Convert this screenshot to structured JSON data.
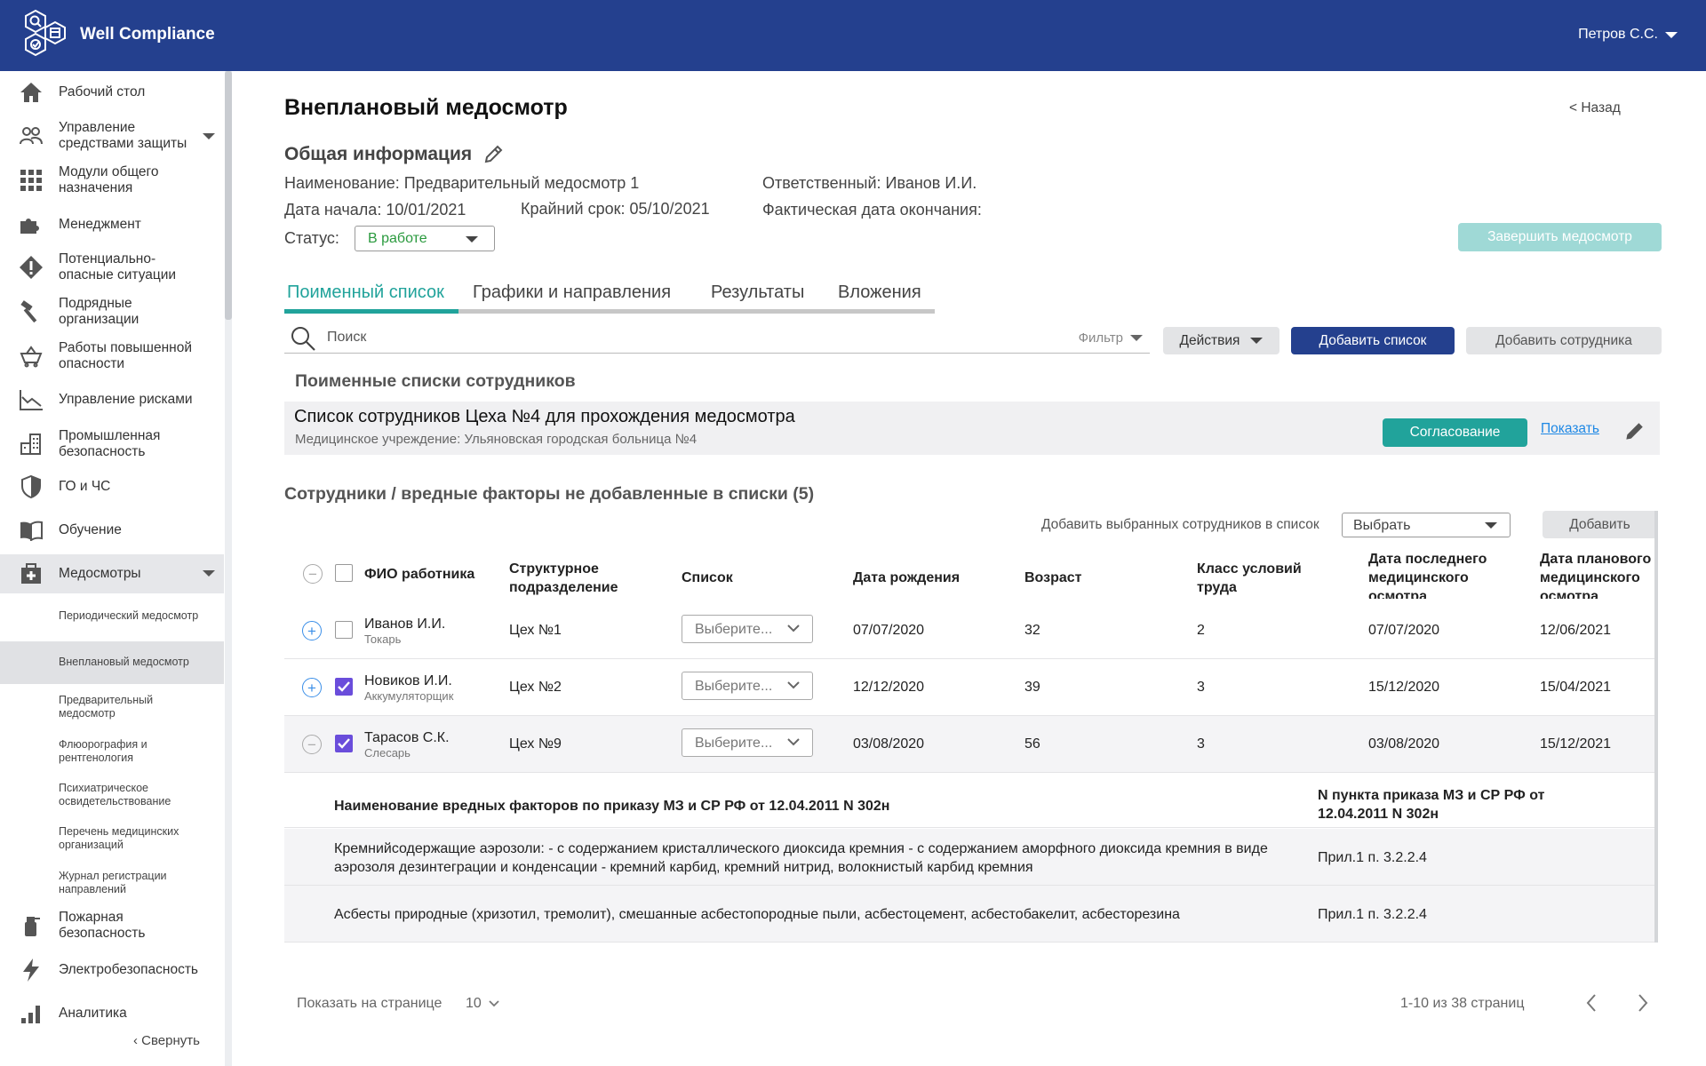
{
  "header": {
    "brand": "Well Compliance",
    "user": "Петров С.С."
  },
  "sidebar": {
    "items": [
      {
        "label": "Рабочий стол",
        "icon": "home-icon"
      },
      {
        "label": "Управление средствами защиты",
        "icon": "users-icon"
      },
      {
        "label": "Модули общего назначения",
        "icon": "grid-icon"
      },
      {
        "label": "Менеджмент",
        "icon": "puzzle-icon"
      },
      {
        "label": "Потенциально-опасные ситуации",
        "icon": "warning-icon"
      },
      {
        "label": "Подрядные организации",
        "icon": "hammer-icon"
      },
      {
        "label": "Работы повышенной опасности",
        "icon": "cart-icon"
      },
      {
        "label": "Управление рисками",
        "icon": "chart-line-icon"
      },
      {
        "label": "Промышленная безопасность",
        "icon": "building-icon"
      },
      {
        "label": "ГО и ЧС",
        "icon": "shield-icon"
      },
      {
        "label": "Обучение",
        "icon": "book-icon"
      },
      {
        "label": "Медосмотры",
        "icon": "medkit-icon"
      },
      {
        "label": "Пожарная безопасность",
        "icon": "fire-extinguisher-icon"
      },
      {
        "label": "Электробезопасность",
        "icon": "lightning-icon"
      },
      {
        "label": "Аналитика",
        "icon": "bar-chart-icon"
      }
    ],
    "subitems": [
      "Периодический медосмотр",
      "Внеплановый медосмотр",
      "Предварительный медосмотр",
      "Флюорография и рентгенология",
      "Психиатрическое освидетельствование",
      "Перечень медицинских организаций",
      "Журнал регистрации направлений"
    ],
    "collapse": "‹ Свернуть"
  },
  "page": {
    "title": "Внеплановый медосмотр",
    "back": "<   Назад",
    "section_title": "Общая информация",
    "name": "Наименование: Предварительный медосмотр 1",
    "start": "Дата начала: 10/01/2021",
    "deadline": "Крайний срок: 05/10/2021",
    "responsible": "Ответственный: Иванов И.И.",
    "actual_end": "Фактическая дата окончания:",
    "status_label": "Статус:",
    "status_value": "В работе",
    "finish_button": "Завершить медосмотр",
    "status_color": "#2a9a3e"
  },
  "tabs": [
    "Поименный список",
    "Графики и направления",
    "Результаты",
    "Вложения"
  ],
  "toolbar": {
    "search_placeholder": "Поиск",
    "filter": "Фильтр",
    "actions": "Действия",
    "add_list": "Добавить список",
    "add_employee": "Добавить сотрудника"
  },
  "lists": {
    "title": "Поименные списки сотрудников",
    "items": [
      {
        "name": "Список сотрудников Цеха №4 для прохождения медосмотра",
        "institution": "Медицинское учреждение: Ульяновская городская больница №4",
        "approve": "Согласование",
        "show": "Показать"
      }
    ]
  },
  "unassigned": {
    "title": "Сотрудники / вредные факторы не добавленные в списки (5)",
    "add_label": "Добавить выбранных сотрудников в список",
    "select": "Выбрать",
    "add_button": "Добавить",
    "columns": {
      "name": "ФИО работника",
      "dept": "Структурное подразделение",
      "list": "Список",
      "birth": "Дата рождения",
      "age": "Возраст",
      "class": "Класс условий труда",
      "last_exam": "Дата последнего медицинского осмотра",
      "planned_exam": "Дата планового медицинского осмотра"
    },
    "rows": [
      {
        "name": "Иванов И.И.",
        "position": "Токарь",
        "dept": "Цех №1",
        "list": "Выберите...",
        "birth": "07/07/2020",
        "age": "32",
        "class": "2",
        "last": "07/07/2020",
        "planned": "12/06/2021",
        "checked": false,
        "expanded": false
      },
      {
        "name": "Новиков И.И.",
        "position": "Аккумуляторщик",
        "dept": "Цех №2",
        "list": "Выберите...",
        "birth": "12/12/2020",
        "age": "39",
        "class": "3",
        "last": "15/12/2020",
        "planned": "15/04/2021",
        "checked": true,
        "expanded": false
      },
      {
        "name": "Тарасов С.К.",
        "position": "Слесарь",
        "dept": "Цех №9",
        "list": "Выберите...",
        "birth": "03/08/2020",
        "age": "56",
        "class": "3",
        "last": "03/08/2020",
        "planned": "15/12/2021",
        "checked": true,
        "expanded": true
      }
    ],
    "factors": {
      "head_name": "Наименование вредных факторов по приказу МЗ и СР РФ от 12.04.2011 N 302н",
      "head_point": "N пункта приказа МЗ и СР РФ от 12.04.2011 N 302н",
      "rows": [
        {
          "name": "Кремнийсодержащие аэрозоли: - с содержанием кристаллического диоксида кремния  - с содержанием аморфного диоксида кремния в виде аэрозоля дезинтеграции и конденсации - кремний карбид, кремний нитрид, волокнистый карбид кремния",
          "point": "Прил.1 п. 3.2.2.4"
        },
        {
          "name": "Асбесты природные (хризотил, тремолит), смешанные асбестопородные пыли, асбестоцемент, асбестобакелит, асбесторезина",
          "point": "Прил.1 п. 3.2.2.4"
        }
      ]
    }
  },
  "pager": {
    "label": "Показать на странице",
    "size": "10",
    "count": "1-10 из 38 страниц"
  },
  "colors": {
    "header": "#24408e",
    "accent": "#21a39b",
    "checkbox": "#6a4ddb"
  }
}
